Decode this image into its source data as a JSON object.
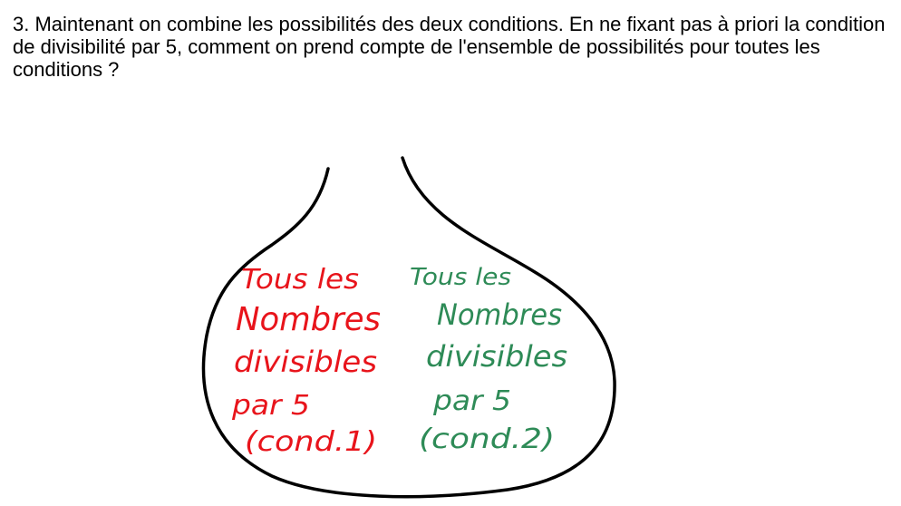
{
  "question": {
    "text": "3. Maintenant on combine les possibilités des deux conditions. En ne fixant pas à priori la condition de divisibilité par 5, comment on prend compte de l'ensemble de possibilités pour toutes les conditions ?"
  },
  "sketch": {
    "left_group": {
      "color": "#e8141b",
      "lines": [
        "Tous les",
        "Nombres",
        "divisibles",
        "par 5",
        "(cond.1)"
      ]
    },
    "right_group": {
      "color": "#2e8b57",
      "lines": [
        "Tous les",
        "Nombres",
        "divisibles",
        "par 5",
        "(cond.2)"
      ]
    }
  }
}
